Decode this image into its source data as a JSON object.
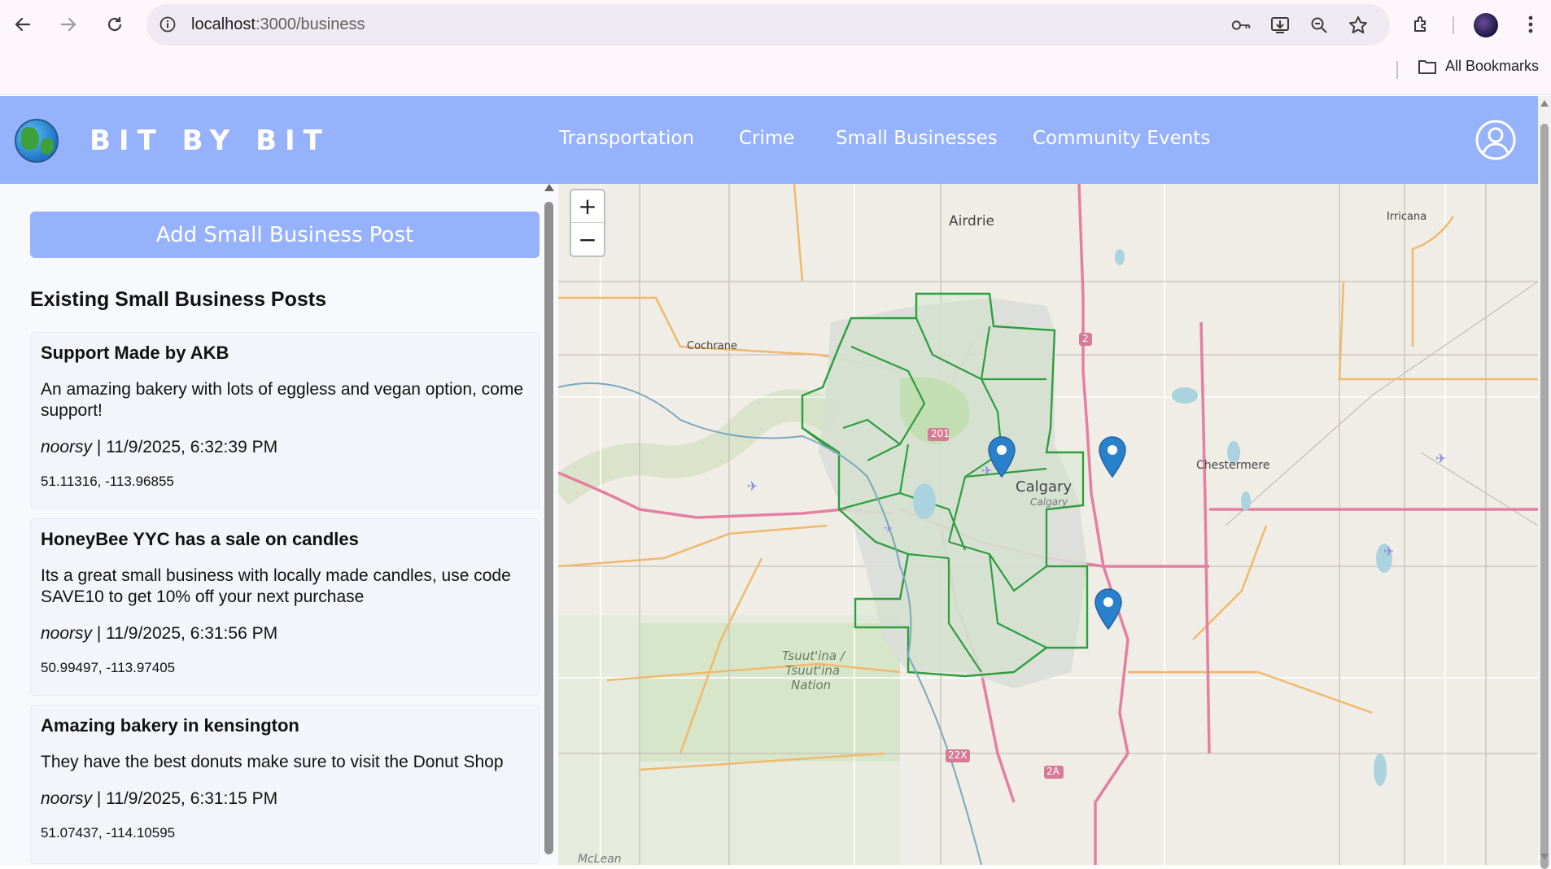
{
  "browser": {
    "url_host": "localhost",
    "url_path": ":3000/business",
    "bookmarks_label": "All Bookmarks"
  },
  "app": {
    "brand": "BIT BY BIT",
    "nav": {
      "transportation": "Transportation",
      "crime": "Crime",
      "small_businesses": "Small Businesses",
      "community_events": "Community Events"
    },
    "header_color": "#97b2fd"
  },
  "sidebar": {
    "add_button": "Add Small Business Post",
    "heading": "Existing Small Business Posts",
    "posts": [
      {
        "title": "Support Made by AKB",
        "body": "An amazing bakery with lots of eggless and vegan option, come support!",
        "author": "noorsy",
        "timestamp": " | 11/9/2025, 6:32:39 PM",
        "coords": "51.11316, -113.96855"
      },
      {
        "title": "HoneyBee YYC has a sale on candles",
        "body": "Its a great small business with locally made candles, use code SAVE10 to get 10% off your next purchase",
        "author": "noorsy",
        "timestamp": " | 11/9/2025, 6:31:56 PM",
        "coords": "50.99497, -113.97405"
      },
      {
        "title": "Amazing bakery in kensington",
        "body": "They have the best donuts make sure to visit the Donut Shop",
        "author": "noorsy",
        "timestamp": " | 11/9/2025, 6:31:15 PM",
        "coords": "51.07437, -114.10595"
      }
    ]
  },
  "map": {
    "zoom_in": "+",
    "zoom_out": "−",
    "labels": {
      "airdrie": "Airdrie",
      "cochrane": "Cochrane",
      "calgary": "Calgary",
      "calgary_small": "Calgary",
      "chestermere": "Chestermere",
      "irricana": "Irricana",
      "tsuutina": "Tsuut'ina /",
      "tsuutina2": "Tsuut'ina",
      "nation": "Nation",
      "mclean": "McLean",
      "hwy_201": "201",
      "hwy_2": "2",
      "hwy_22x": "22X",
      "hwy_2a": "2A"
    },
    "marker_color": "#2a81cb",
    "boundary_color": "#2e9e3e"
  }
}
